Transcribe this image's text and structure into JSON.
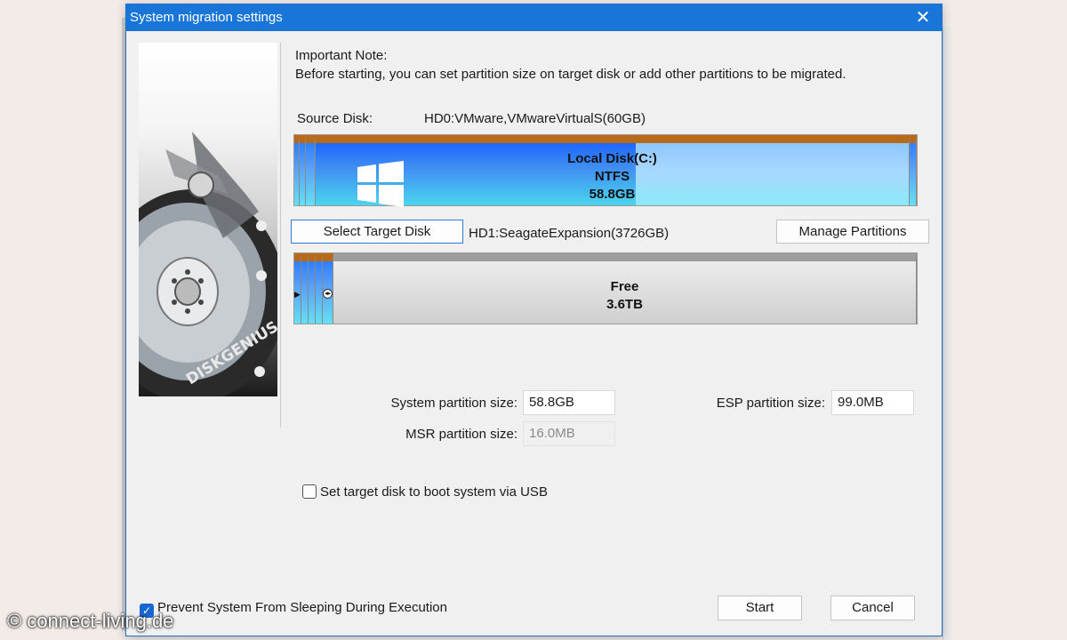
{
  "dialog": {
    "title": "System migration settings",
    "close_glyph": "✕",
    "note_title": "Important Note:",
    "note_text": "Before starting, you can set partition size on target disk or add other partitions to be migrated.",
    "side_image_brand": "DISKGENIUS"
  },
  "source": {
    "label": "Source Disk:",
    "value": "HD0:VMware,VMwareVirtualS(60GB)",
    "partition": {
      "name": "Local Disk(C:)",
      "fs": "NTFS",
      "size": "58.8GB",
      "used_fraction": 0.54
    }
  },
  "target": {
    "select_button": "Select Target Disk",
    "value": "HD1:SeagateExpansion(3726GB)",
    "manage_button": "Manage Partitions",
    "free_label": "Free",
    "free_size": "3.6TB"
  },
  "fields": {
    "system_label": "System partition size:",
    "system_value": "58.8GB",
    "esp_label": "ESP partition size:",
    "esp_value": "99.0MB",
    "msr_label": "MSR partition size:",
    "msr_value": "16.0MB"
  },
  "options": {
    "usb_boot": "Set target disk to boot system via USB",
    "usb_boot_checked": false,
    "prevent_sleep": "Prevent System From Sleeping During Execution",
    "prevent_sleep_checked": true
  },
  "buttons": {
    "start": "Start",
    "cancel": "Cancel"
  },
  "watermark": "© connect-living.de",
  "colors": {
    "title_bar": "#1976d8",
    "partition_header": "#b86a18",
    "partition_fill": "#3f8ff2",
    "free_header": "#9d9d9d"
  }
}
